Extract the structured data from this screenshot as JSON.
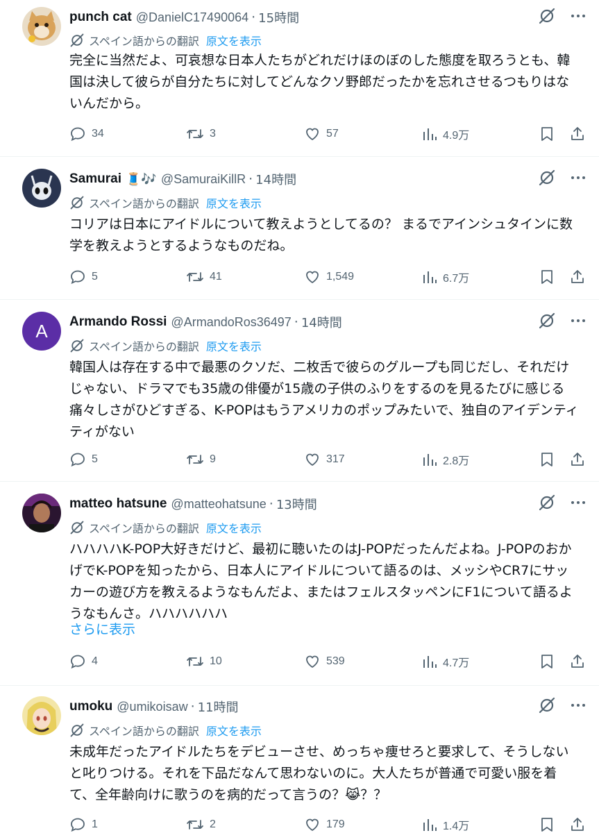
{
  "translate_label": "スペイン語からの翻訳",
  "show_original_label": "原文を表示",
  "show_more_label": "さらに表示",
  "colors": {
    "text": "#0f1419",
    "muted": "#536471",
    "link": "#1d9bf0"
  },
  "tweets": [
    {
      "name": "punch cat",
      "badge": "",
      "handle": "@DanielC17490064",
      "time": "15時間",
      "avatar_icon": "cat-photo-avatar",
      "text": "完全に当然だよ、可哀想な日本人たちがどれだけほのぼのした態度を取ろうとも、韓国は決して彼らが自分たちに対してどんなクソ野郎だったかを忘れさせるつもりはないんだから。",
      "replies": "34",
      "reposts": "3",
      "likes": "57",
      "views": "4.9万"
    },
    {
      "name": "Samurai",
      "badge": "🧵🎶",
      "handle": "@SamuraiKillR",
      "time": "14時間",
      "avatar_icon": "hollow-knight-avatar",
      "text": "コリアは日本にアイドルについて教えようとしてるの？ まるでアインシュタインに数学を教えようとするようなものだね。",
      "replies": "5",
      "reposts": "41",
      "likes": "1,549",
      "views": "6.7万"
    },
    {
      "name": "Armando Rossi",
      "badge": "",
      "handle": "@ArmandoRos36497",
      "time": "14時間",
      "avatar_letter": "A",
      "text": "韓国人は存在する中で最悪のクソだ、二枚舌で彼らのグループも同じだし、それだけじゃない、ドラマでも35歳の俳優が15歳の子供のふりをするのを見るたびに感じる痛々しさがひどすぎる、K-POPはもうアメリカのポップみたいで、独自のアイデンティティがない",
      "replies": "5",
      "reposts": "9",
      "likes": "317",
      "views": "2.8万"
    },
    {
      "name": "matteo hatsune",
      "badge": "",
      "handle": "@matteohatsune",
      "time": "13時間",
      "avatar_icon": "person-photo-avatar",
      "text": "ハハハハK-POP大好きだけど、最初に聴いたのはJ-POPだったんだよね。J-POPのおかげでK-POPを知ったから、日本人にアイドルについて語るのは、メッシやCR7にサッカーの遊び方を教えるようなもんだよ、またはフェルスタッペンにF1について語るようなもんさ。ハハハハハハ",
      "replies": "4",
      "reposts": "10",
      "likes": "539",
      "views": "4.7万"
    },
    {
      "name": "umoku",
      "badge": "",
      "handle": "@umikoisaw",
      "time": "11時間",
      "avatar_icon": "anime-girl-avatar",
      "text": "未成年だったアイドルたちをデビューさせ、めっちゃ痩せろと要求して、そうしないと叱りつける。それを下品だなんて思わないのに。大人たちが普通で可愛い服を着て、全年齢向けに歌うのを病的だって言うの？😹？？",
      "replies": "1",
      "reposts": "2",
      "likes": "179",
      "views": "1.4万"
    }
  ]
}
